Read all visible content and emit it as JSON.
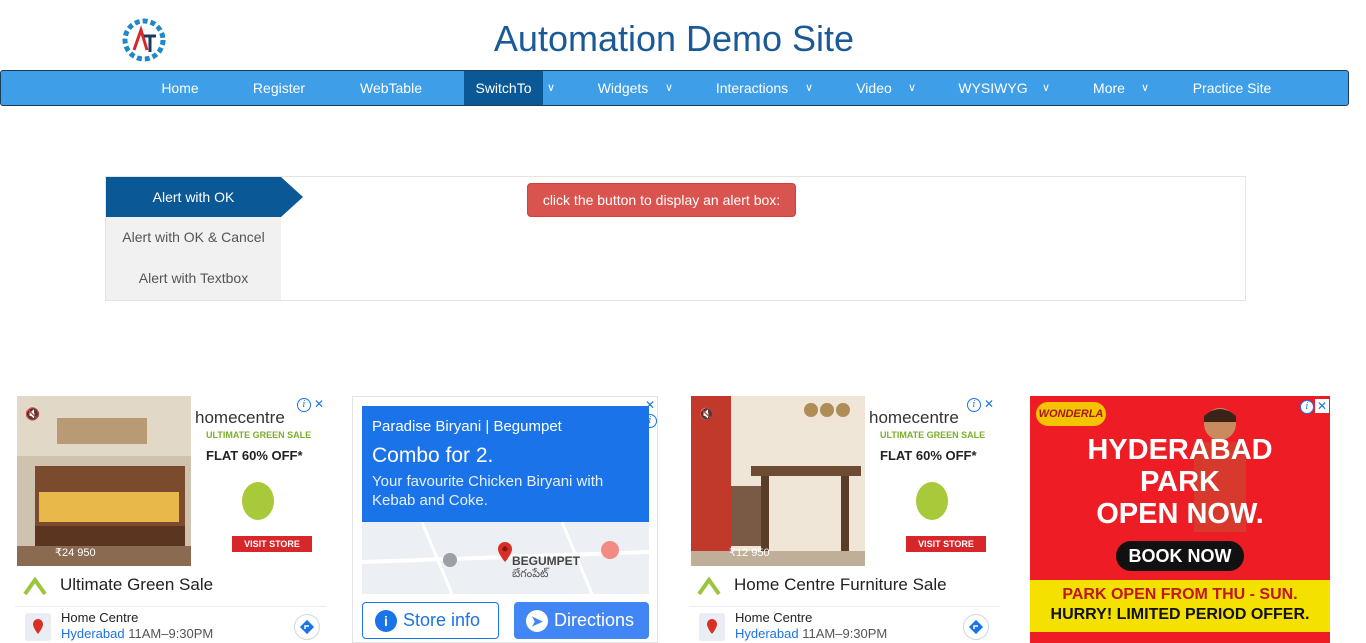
{
  "header": {
    "title": "Automation Demo Site"
  },
  "nav": {
    "items": [
      {
        "label": "Home"
      },
      {
        "label": "Register"
      },
      {
        "label": "WebTable"
      },
      {
        "label": "SwitchTo"
      },
      {
        "label": "Widgets"
      },
      {
        "label": "Interactions"
      },
      {
        "label": "Video"
      },
      {
        "label": "WYSIWYG"
      },
      {
        "label": "More"
      },
      {
        "label": "Practice Site"
      }
    ],
    "active": "SwitchTo"
  },
  "alerts": {
    "tabs": [
      {
        "label": "Alert with OK"
      },
      {
        "label": "Alert with OK & Cancel"
      },
      {
        "label": "Alert with Textbox"
      }
    ],
    "button_label": "click the button to display an alert box:"
  },
  "ads": {
    "ad1": {
      "brand": "homecentre",
      "sale": "ULTIMATE GREEN SALE",
      "flat": "FLAT 60% OFF*",
      "visit": "VISIT STORE",
      "price": "₹24 950",
      "title": "Ultimate Green Sale",
      "store": "Home Centre",
      "city": "Hyderabad",
      "hours": "11AM–9:30PM"
    },
    "ad2": {
      "brand": "Paradise Biryani | Begumpet",
      "headline": "Combo for 2.",
      "description": "Your favourite Chicken Biryani with Kebab and Coke.",
      "map_label": "BEGUMPET",
      "map_label_local": "బేగంపేట్",
      "store_info": "Store info",
      "directions": "Directions"
    },
    "ad3": {
      "brand": "homecentre",
      "sale": "ULTIMATE GREEN SALE",
      "flat": "FLAT 60% OFF*",
      "visit": "VISIT STORE",
      "price": "₹12 950",
      "title": "Home Centre Furniture Sale",
      "store": "Home Centre",
      "city": "Hyderabad",
      "hours": "11AM–9:30PM"
    },
    "ad4": {
      "logo": "WONDERLA",
      "headline_line1": "HYDERABAD",
      "headline_line2": "PARK",
      "headline_line3": "OPEN NOW.",
      "book": "BOOK NOW",
      "line1": "PARK OPEN FROM THU - SUN.",
      "line2": "HURRY! LIMITED PERIOD OFFER."
    }
  },
  "colors": {
    "title": "#1a5a96",
    "nav_bg": "#3e9ee8",
    "nav_active": "#0b5896",
    "alert_button": "#d9534f"
  }
}
